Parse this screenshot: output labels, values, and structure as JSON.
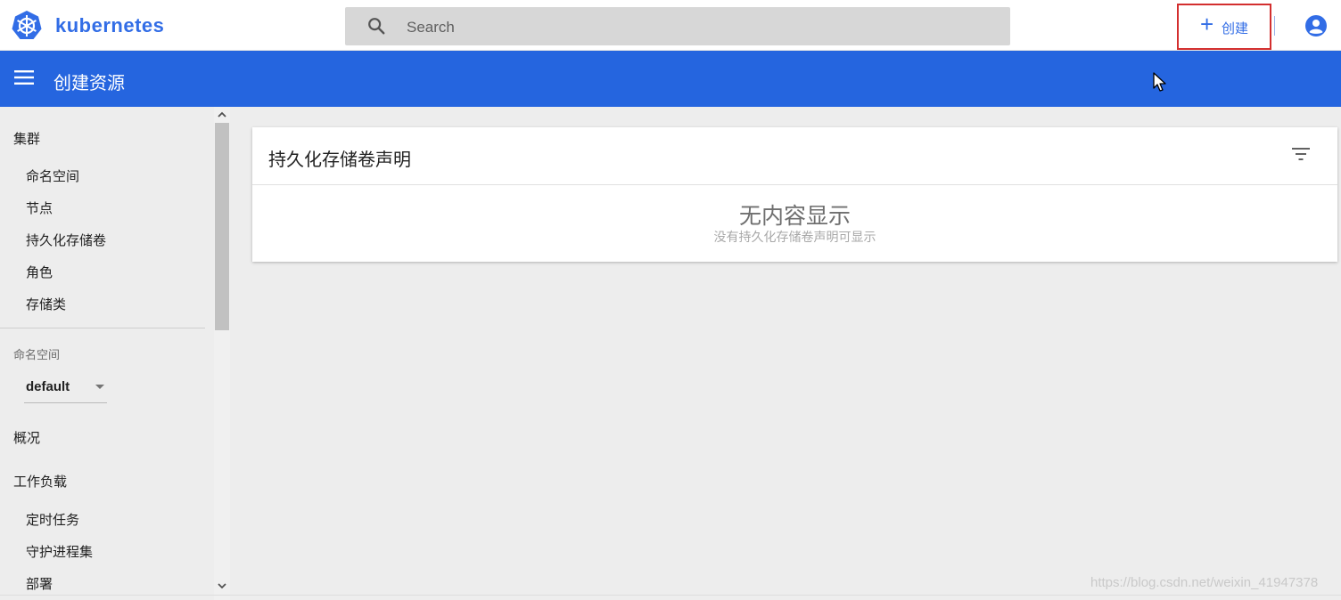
{
  "topbar": {
    "brand": "kubernetes",
    "search_placeholder": "Search",
    "create_plus": "+",
    "create_label": "创建"
  },
  "header": {
    "title": "创建资源"
  },
  "sidebar": {
    "cluster_heading": "集群",
    "cluster_items": [
      "命名空间",
      "节点",
      "持久化存储卷",
      "角色",
      "存储类"
    ],
    "namespace_label": "命名空间",
    "namespace_value": "default",
    "overview": "概况",
    "workloads_heading": "工作负载",
    "workload_items": [
      "定时任务",
      "守护进程集",
      "部署"
    ]
  },
  "card": {
    "title": "持久化存储卷声明",
    "empty_title": "无内容显示",
    "empty_subtitle": "没有持久化存储卷声明可显示"
  },
  "watermark": "https://blog.csdn.net/weixin_41947378",
  "colors": {
    "accent": "#326de6",
    "header_blue": "#2565df",
    "highlight_border": "#d32f2f"
  }
}
